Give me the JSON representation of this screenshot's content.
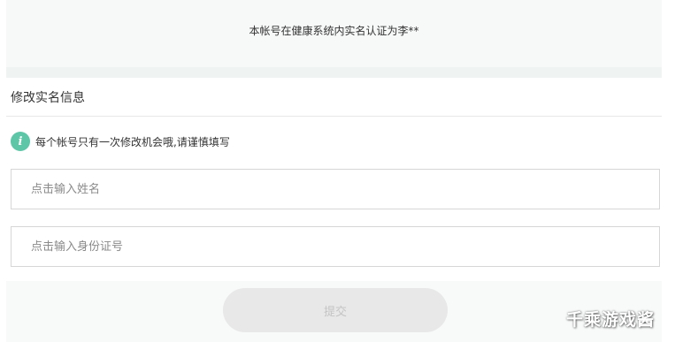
{
  "notice": {
    "text": "本帐号在健康系统内实名认证为李**"
  },
  "section": {
    "title": "修改实名信息"
  },
  "tip": {
    "icon": "info-icon",
    "icon_glyph": "i",
    "icon_color": "#5cc6a6",
    "text": "每个帐号只有一次修改机会哦,请谨慎填写"
  },
  "form": {
    "name_field": {
      "placeholder": "点击输入姓名",
      "value": ""
    },
    "id_field": {
      "placeholder": "点击输入身份证号",
      "value": ""
    },
    "submit_label": "提交"
  },
  "watermark": {
    "text": "千乘游戏酱"
  }
}
